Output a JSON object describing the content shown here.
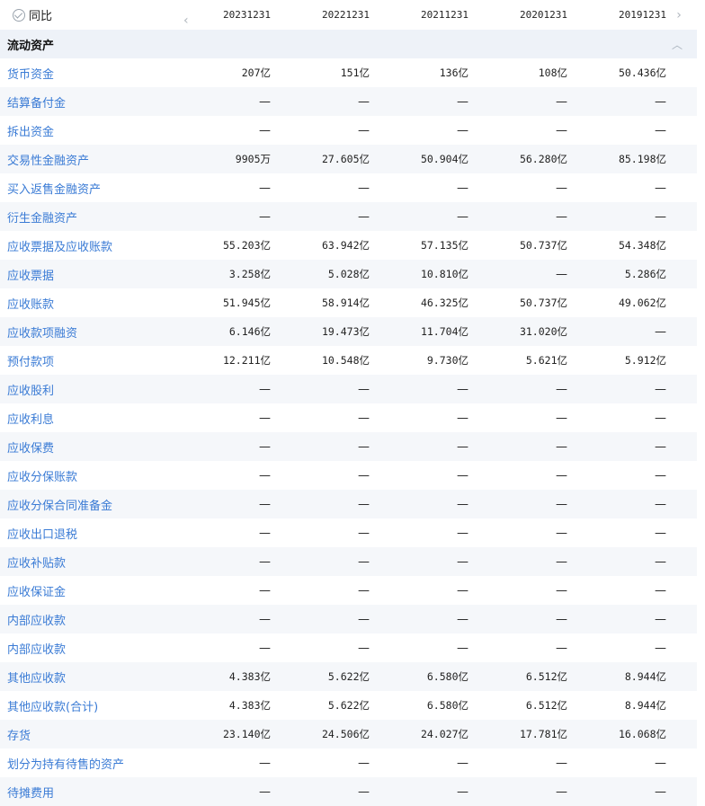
{
  "header": {
    "compare_label": "同比",
    "periods": [
      "20231231",
      "20221231",
      "20211231",
      "20201231",
      "20191231"
    ]
  },
  "section": {
    "title": "流动资产"
  },
  "rows": [
    {
      "label": "货币资金",
      "values": [
        "207亿",
        "151亿",
        "136亿",
        "108亿",
        "50.436亿"
      ]
    },
    {
      "label": "结算备付金",
      "values": [
        "—",
        "—",
        "—",
        "—",
        "—"
      ]
    },
    {
      "label": "拆出资金",
      "values": [
        "—",
        "—",
        "—",
        "—",
        "—"
      ]
    },
    {
      "label": "交易性金融资产",
      "values": [
        "9905万",
        "27.605亿",
        "50.904亿",
        "56.280亿",
        "85.198亿"
      ]
    },
    {
      "label": "买入返售金融资产",
      "values": [
        "—",
        "—",
        "—",
        "—",
        "—"
      ]
    },
    {
      "label": "衍生金融资产",
      "values": [
        "—",
        "—",
        "—",
        "—",
        "—"
      ]
    },
    {
      "label": "应收票据及应收账款",
      "values": [
        "55.203亿",
        "63.942亿",
        "57.135亿",
        "50.737亿",
        "54.348亿"
      ]
    },
    {
      "label": "应收票据",
      "values": [
        "3.258亿",
        "5.028亿",
        "10.810亿",
        "—",
        "5.286亿"
      ]
    },
    {
      "label": "应收账款",
      "values": [
        "51.945亿",
        "58.914亿",
        "46.325亿",
        "50.737亿",
        "49.062亿"
      ]
    },
    {
      "label": "应收款项融资",
      "values": [
        "6.146亿",
        "19.473亿",
        "11.704亿",
        "31.020亿",
        "—"
      ]
    },
    {
      "label": "预付款项",
      "values": [
        "12.211亿",
        "10.548亿",
        "9.730亿",
        "5.621亿",
        "5.912亿"
      ]
    },
    {
      "label": "应收股利",
      "values": [
        "—",
        "—",
        "—",
        "—",
        "—"
      ]
    },
    {
      "label": "应收利息",
      "values": [
        "—",
        "—",
        "—",
        "—",
        "—"
      ]
    },
    {
      "label": "应收保费",
      "values": [
        "—",
        "—",
        "—",
        "—",
        "—"
      ]
    },
    {
      "label": "应收分保账款",
      "values": [
        "—",
        "—",
        "—",
        "—",
        "—"
      ]
    },
    {
      "label": "应收分保合同准备金",
      "values": [
        "—",
        "—",
        "—",
        "—",
        "—"
      ]
    },
    {
      "label": "应收出口退税",
      "values": [
        "—",
        "—",
        "—",
        "—",
        "—"
      ]
    },
    {
      "label": "应收补贴款",
      "values": [
        "—",
        "—",
        "—",
        "—",
        "—"
      ]
    },
    {
      "label": "应收保证金",
      "values": [
        "—",
        "—",
        "—",
        "—",
        "—"
      ]
    },
    {
      "label": "内部应收款",
      "values": [
        "—",
        "—",
        "—",
        "—",
        "—"
      ]
    },
    {
      "label": "内部应收款",
      "values": [
        "—",
        "—",
        "—",
        "—",
        "—"
      ]
    },
    {
      "label": "其他应收款",
      "values": [
        "4.383亿",
        "5.622亿",
        "6.580亿",
        "6.512亿",
        "8.944亿"
      ]
    },
    {
      "label": "其他应收款(合计)",
      "values": [
        "4.383亿",
        "5.622亿",
        "6.580亿",
        "6.512亿",
        "8.944亿"
      ]
    },
    {
      "label": "存货",
      "values": [
        "23.140亿",
        "24.506亿",
        "24.027亿",
        "17.781亿",
        "16.068亿"
      ]
    },
    {
      "label": "划分为持有待售的资产",
      "values": [
        "—",
        "—",
        "—",
        "—",
        "—"
      ]
    },
    {
      "label": "待摊费用",
      "values": [
        "—",
        "—",
        "—",
        "—",
        "—"
      ]
    }
  ]
}
